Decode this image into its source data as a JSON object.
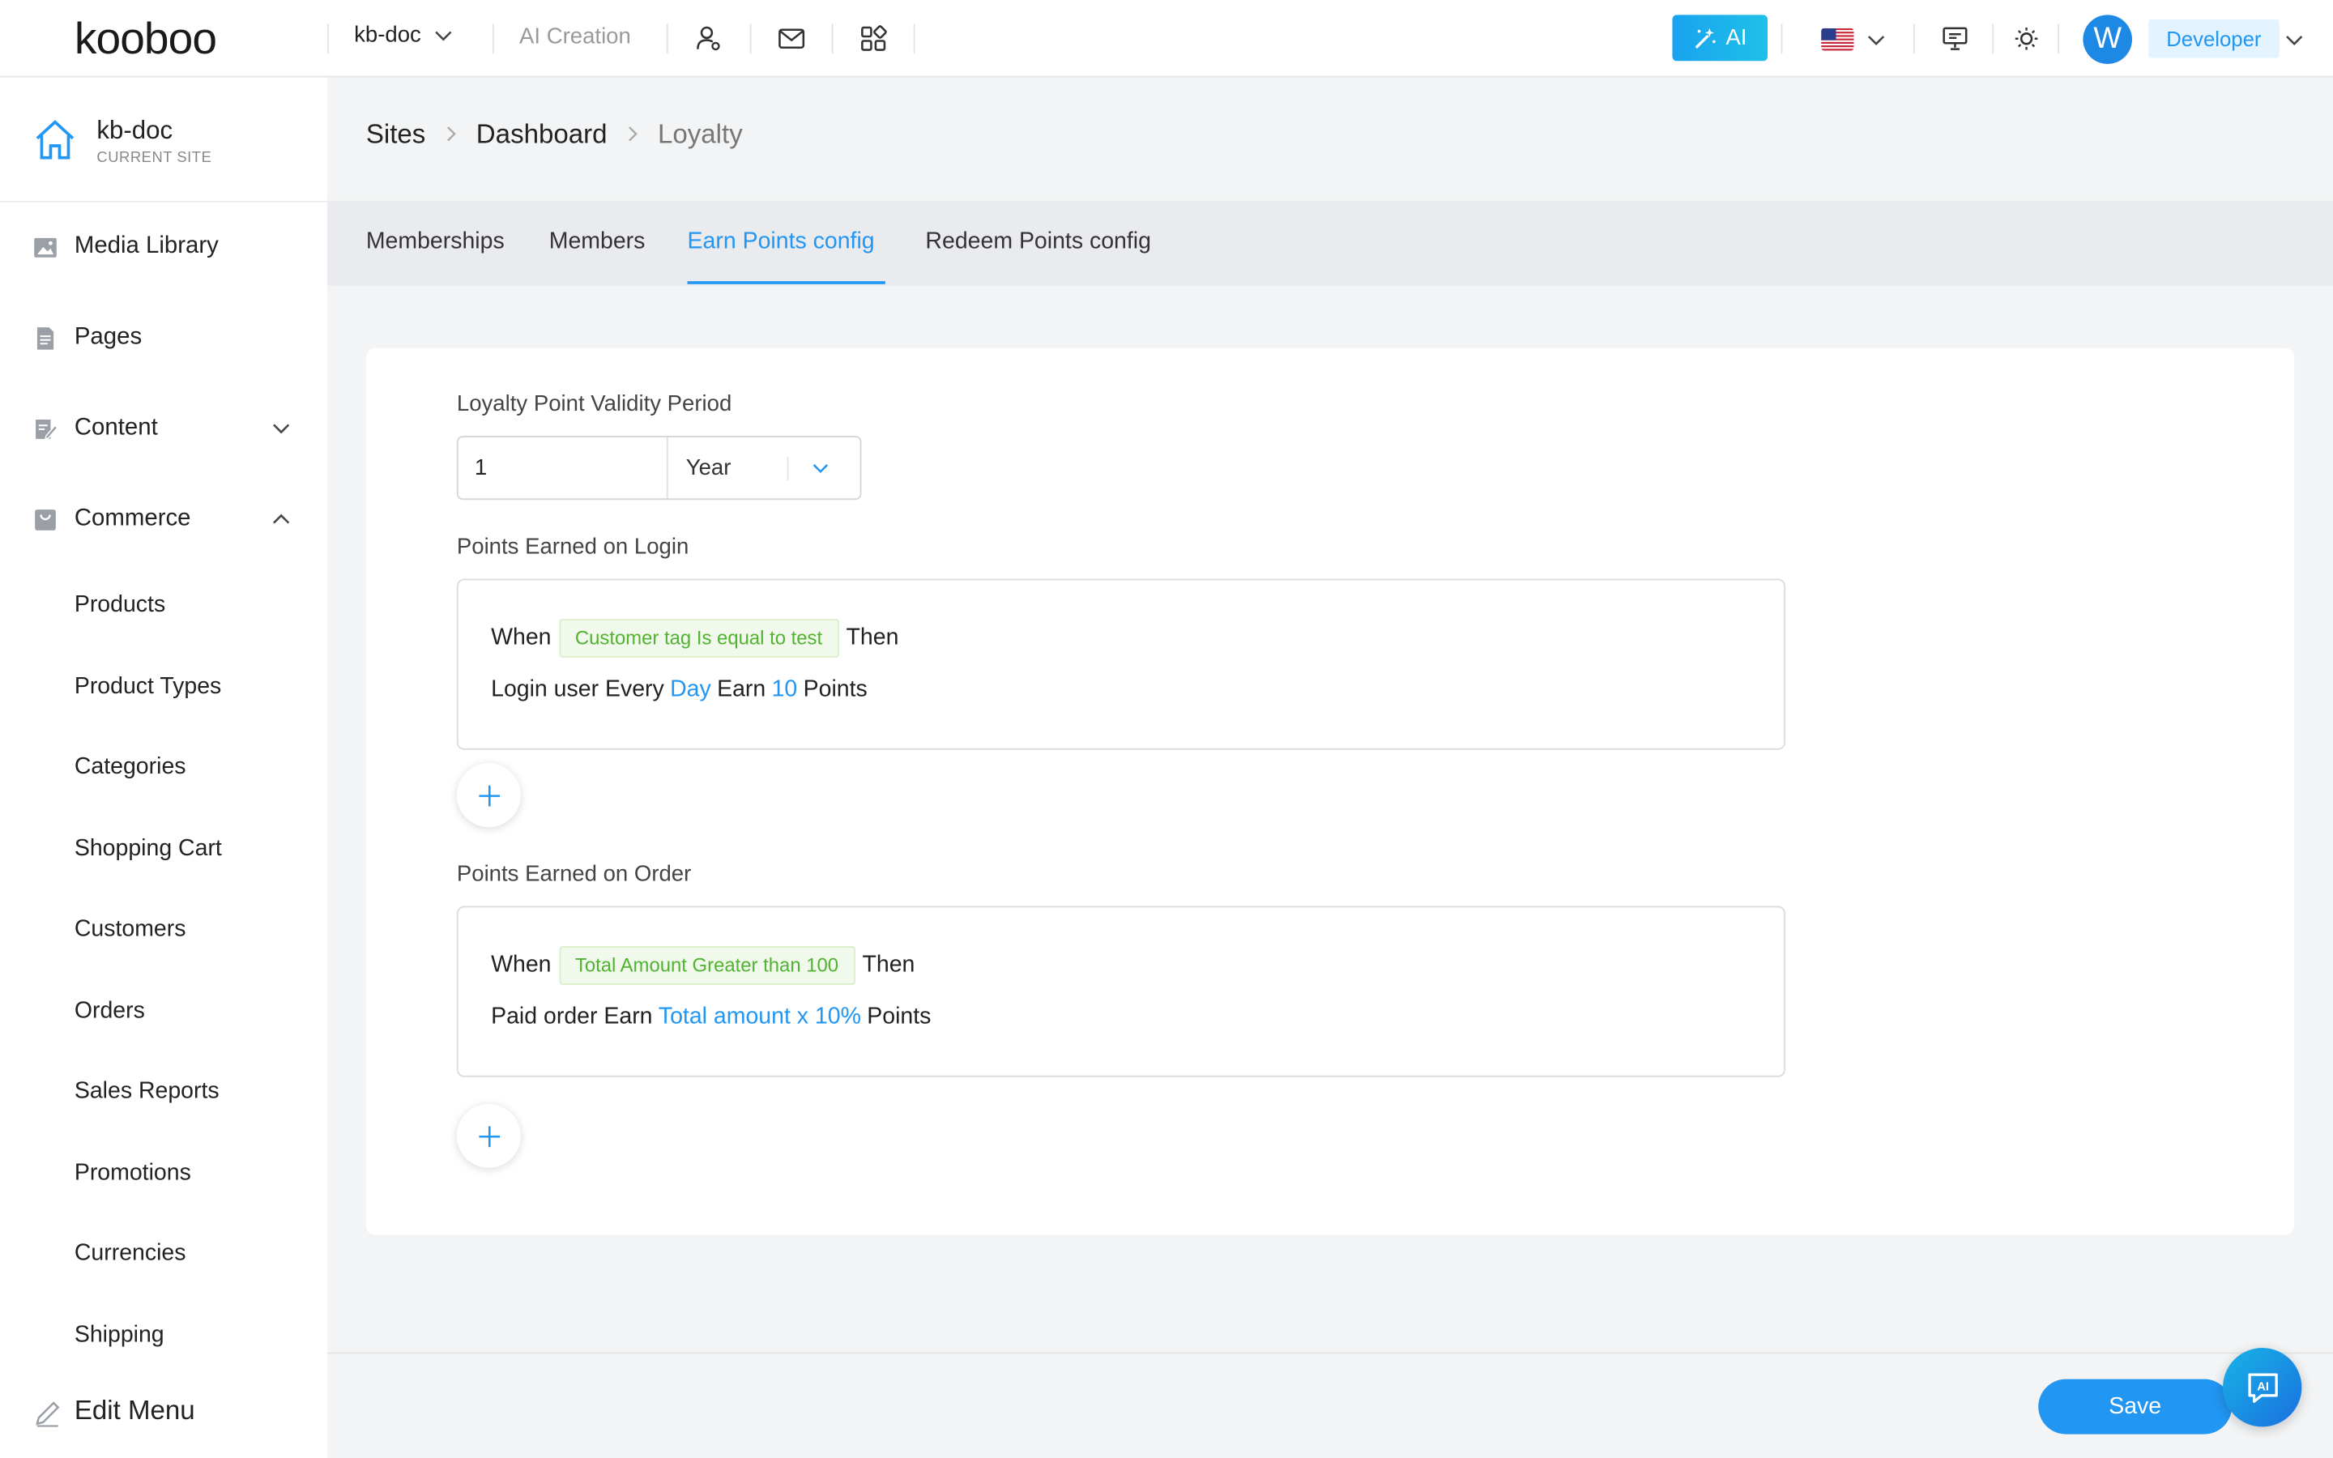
{
  "app": {
    "logo_text": "kooboo",
    "site_switch": "kb-doc",
    "ai_creation": "AI Creation",
    "ai_button": "AI",
    "avatar_initial": "W",
    "role": "Developer",
    "accent": "#2196f3"
  },
  "sidebar": {
    "site_name": "kb-doc",
    "site_sub": "CURRENT SITE",
    "items": [
      {
        "label": "Media Library",
        "icon": "image-icon"
      },
      {
        "label": "Pages",
        "icon": "document-icon"
      },
      {
        "label": "Content",
        "icon": "edit-doc-icon"
      },
      {
        "label": "Commerce",
        "icon": "bag-icon"
      }
    ],
    "commerce_items": [
      "Products",
      "Product Types",
      "Categories",
      "Shopping Cart",
      "Customers",
      "Orders",
      "Sales Reports",
      "Promotions",
      "Currencies",
      "Shipping"
    ],
    "edit_menu": "Edit Menu"
  },
  "breadcrumb": [
    "Sites",
    "Dashboard",
    "Loyalty"
  ],
  "tabs": [
    "Memberships",
    "Members",
    "Earn Points config",
    "Redeem Points config"
  ],
  "form": {
    "validity_label": "Loyalty Point Validity Period",
    "validity_value": "1",
    "validity_unit": "Year",
    "login_label": "Points Earned on Login",
    "login_rule": {
      "when": "When",
      "condition": "Customer tag Is equal to test",
      "then": "Then",
      "prefix": "Login user Every",
      "period": "Day",
      "earn": "Earn",
      "amount": "10",
      "suffix": "Points"
    },
    "order_label": "Points Earned on Order",
    "order_rule": {
      "when": "When",
      "condition": "Total Amount Greater than 100",
      "then": "Then",
      "prefix": "Paid order Earn",
      "amount": "Total amount x 10%",
      "suffix": "Points"
    }
  },
  "actions": {
    "save": "Save",
    "ai_float": "AI"
  }
}
